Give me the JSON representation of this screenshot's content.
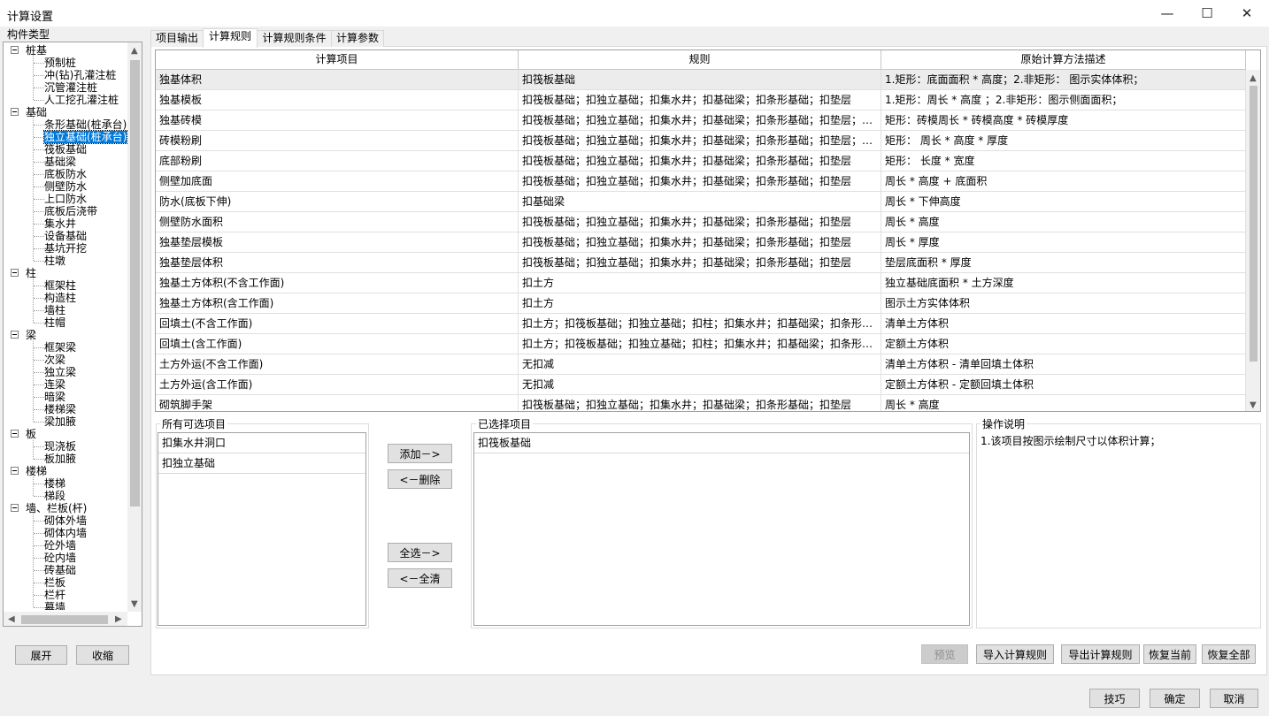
{
  "window": {
    "title": "计算设置",
    "min_glyph": "—",
    "max_glyph": "☐",
    "close_glyph": "✕"
  },
  "tree": {
    "label": "构件类型",
    "nodes": [
      {
        "text": "桩基",
        "level": 0
      },
      {
        "text": "预制桩",
        "level": 1
      },
      {
        "text": "冲(钻)孔灌注桩",
        "level": 1
      },
      {
        "text": "沉管灌注桩",
        "level": 1
      },
      {
        "text": "人工挖孔灌注桩",
        "level": 1
      },
      {
        "text": "基础",
        "level": 0
      },
      {
        "text": "条形基础(桩承台)",
        "level": 1
      },
      {
        "text": "独立基础(桩承台)",
        "level": 1,
        "selected": true
      },
      {
        "text": "筏板基础",
        "level": 1
      },
      {
        "text": "基础梁",
        "level": 1
      },
      {
        "text": "底板防水",
        "level": 1
      },
      {
        "text": "侧壁防水",
        "level": 1
      },
      {
        "text": "上口防水",
        "level": 1
      },
      {
        "text": "底板后浇带",
        "level": 1
      },
      {
        "text": "集水井",
        "level": 1
      },
      {
        "text": "设备基础",
        "level": 1
      },
      {
        "text": "基坑开挖",
        "level": 1
      },
      {
        "text": "柱墩",
        "level": 1
      },
      {
        "text": "柱",
        "level": 0
      },
      {
        "text": "框架柱",
        "level": 1
      },
      {
        "text": "构造柱",
        "level": 1
      },
      {
        "text": "墙柱",
        "level": 1
      },
      {
        "text": "柱帽",
        "level": 1
      },
      {
        "text": "梁",
        "level": 0
      },
      {
        "text": "框架梁",
        "level": 1
      },
      {
        "text": "次梁",
        "level": 1
      },
      {
        "text": "独立梁",
        "level": 1
      },
      {
        "text": "连梁",
        "level": 1
      },
      {
        "text": "暗梁",
        "level": 1
      },
      {
        "text": "楼梯梁",
        "level": 1
      },
      {
        "text": "梁加腋",
        "level": 1
      },
      {
        "text": "板",
        "level": 0
      },
      {
        "text": "现浇板",
        "level": 1
      },
      {
        "text": "板加腋",
        "level": 1
      },
      {
        "text": "楼梯",
        "level": 0
      },
      {
        "text": "楼梯",
        "level": 1
      },
      {
        "text": "梯段",
        "level": 1
      },
      {
        "text": "墙、栏板(杆)",
        "level": 0
      },
      {
        "text": "砌体外墙",
        "level": 1
      },
      {
        "text": "砌体内墙",
        "level": 1
      },
      {
        "text": "砼外墙",
        "level": 1
      },
      {
        "text": "砼内墙",
        "level": 1
      },
      {
        "text": "砖基础",
        "level": 1
      },
      {
        "text": "栏板",
        "level": 1
      },
      {
        "text": "栏杆",
        "level": 1
      },
      {
        "text": "幕墙",
        "level": 1
      }
    ]
  },
  "tree_buttons": {
    "expand": "展开",
    "collapse": "收缩"
  },
  "tabs": [
    "项目输出",
    "计算规则",
    "计算规则条件",
    "计算参数"
  ],
  "active_tab": 1,
  "grid": {
    "headers": [
      "计算项目",
      "规则",
      "原始计算方法描述"
    ],
    "rows": [
      [
        "独基体积",
        "扣筏板基础",
        "1.矩形：底面面积 * 高度；2.非矩形： 图示实体体积；"
      ],
      [
        "独基模板",
        "扣筏板基础；扣独立基础；扣集水井；扣基础梁；扣条形基础；扣垫层",
        "1.矩形：周长 * 高度 ；2.非矩形：图示侧面面积；"
      ],
      [
        "独基砖模",
        "扣筏板基础；扣独立基础；扣集水井；扣基础梁；扣条形基础；扣垫层；扣柱墩；扣地沟",
        "矩形：砖模周长 * 砖模高度 * 砖模厚度"
      ],
      [
        "砖模粉刷",
        "扣筏板基础；扣独立基础；扣集水井；扣基础梁；扣条形基础；扣垫层；扣柱墩；扣地沟",
        "矩形： 周长 * 高度 * 厚度"
      ],
      [
        "底部粉刷",
        "扣筏板基础；扣独立基础；扣集水井；扣基础梁；扣条形基础；扣垫层",
        "矩形： 长度 * 宽度"
      ],
      [
        "侧壁加底面",
        "扣筏板基础；扣独立基础；扣集水井；扣基础梁；扣条形基础；扣垫层",
        "周长 * 高度 + 底面积"
      ],
      [
        "防水(底板下伸)",
        "扣基础梁",
        "周长 * 下伸高度"
      ],
      [
        "侧壁防水面积",
        "扣筏板基础；扣独立基础；扣集水井；扣基础梁；扣条形基础；扣垫层",
        "周长 * 高度"
      ],
      [
        "独基垫层模板",
        "扣筏板基础；扣独立基础；扣集水井；扣基础梁；扣条形基础；扣垫层",
        "周长 * 厚度"
      ],
      [
        "独基垫层体积",
        "扣筏板基础；扣独立基础；扣集水井；扣基础梁；扣条形基础；扣垫层",
        "垫层底面积 * 厚度"
      ],
      [
        "独基土方体积(不含工作面)",
        "扣土方",
        "独立基础底面积 * 土方深度"
      ],
      [
        "独基土方体积(含工作面)",
        "扣土方",
        "图示土方实体体积"
      ],
      [
        "回填土(不含工作面)",
        "扣土方；扣筏板基础；扣独立基础；扣柱；扣集水井；扣基础梁；扣条形基础；扣垫层",
        "清单土方体积"
      ],
      [
        "回填土(含工作面)",
        "扣土方；扣筏板基础；扣独立基础；扣柱；扣集水井；扣基础梁；扣条形基础；扣垫层",
        "定额土方体积"
      ],
      [
        "土方外运(不含工作面)",
        "无扣减",
        "清单土方体积 - 清单回填土体积"
      ],
      [
        "土方外运(含工作面)",
        "无扣减",
        "定额土方体积 - 定额回填土体积"
      ],
      [
        "砌筑脚手架",
        "扣筏板基础；扣独立基础；扣集水井；扣基础梁；扣条形基础；扣垫层",
        "周长 * 高度"
      ]
    ]
  },
  "available": {
    "title": "所有可选项目",
    "items": [
      "扣集水井洞口",
      "扣独立基础"
    ]
  },
  "selected": {
    "title": "已选择项目",
    "items": [
      "扣筏板基础"
    ]
  },
  "mid_buttons": {
    "add": "添加－>",
    "delete": "<－删除",
    "select_all": "全选－>",
    "clear_all": "<－全清"
  },
  "instructions": {
    "title": "操作说明",
    "text": "1.该项目按图示绘制尺寸以体积计算；"
  },
  "bottom_buttons": {
    "preview": "预览",
    "import": "导入计算规则",
    "export": "导出计算规则",
    "restore_current": "恢复当前",
    "restore_all": "恢复全部"
  },
  "footer_buttons": {
    "tips": "技巧",
    "ok": "确定",
    "cancel": "取消"
  }
}
